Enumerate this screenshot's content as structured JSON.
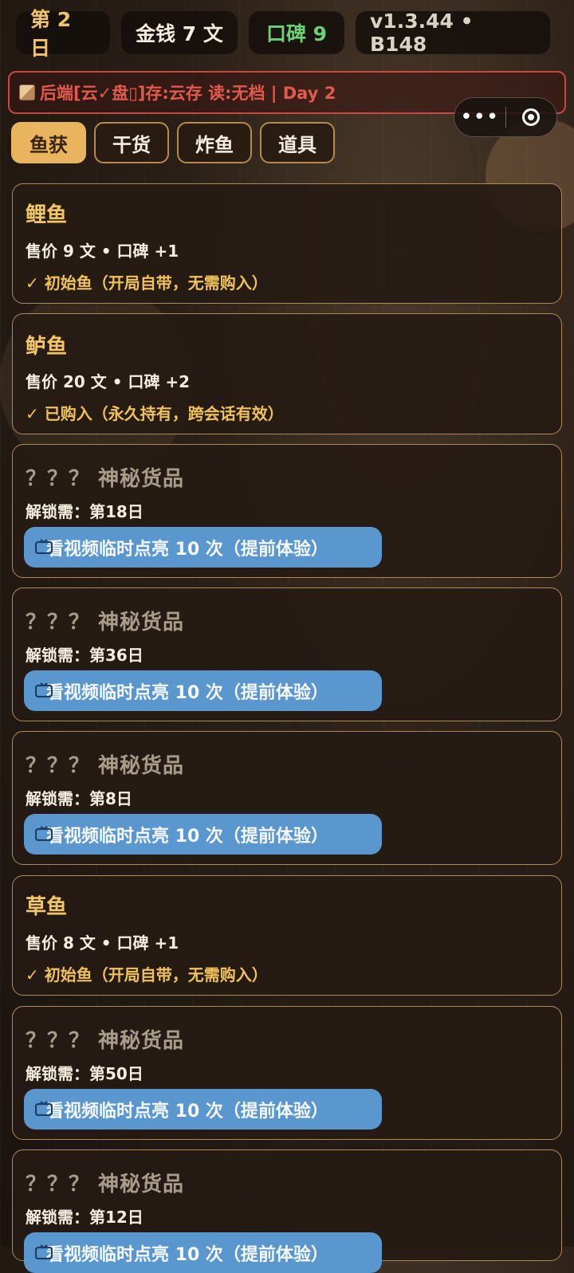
{
  "stats": {
    "day": "第 2 日",
    "money": "金钱 7 文",
    "reputation": "口碑 9",
    "version": "v1.3.44 • B148"
  },
  "banner": {
    "text": "后端[云✓盘▯]存:云存 读:无档 | Day 2"
  },
  "capsule": {
    "more_label": "•••"
  },
  "tabs": [
    {
      "label": "鱼获",
      "active": true
    },
    {
      "label": "干货",
      "active": false
    },
    {
      "label": "炸鱼",
      "active": false
    },
    {
      "label": "道具",
      "active": false
    }
  ],
  "items": [
    {
      "type": "unlocked",
      "name": "鲤鱼",
      "price_line": "售价 9 文 • 口碑 +1",
      "status": "✓ 初始鱼（开局自带，无需购入）"
    },
    {
      "type": "unlocked",
      "name": "鲈鱼",
      "price_line": "售价 20 文 • 口碑 +2",
      "status": "✓ 已购入（永久持有，跨会话有效）"
    },
    {
      "type": "locked",
      "name": "？？？ 神秘货品",
      "unlock": "解锁需：第18日",
      "button": "看视频临时点亮 10 次（提前体验）"
    },
    {
      "type": "locked",
      "name": "？？？ 神秘货品",
      "unlock": "解锁需：第36日",
      "button": "看视频临时点亮 10 次（提前体验）"
    },
    {
      "type": "locked",
      "name": "？？？ 神秘货品",
      "unlock": "解锁需：第8日",
      "button": "看视频临时点亮 10 次（提前体验）"
    },
    {
      "type": "unlocked",
      "name": "草鱼",
      "price_line": "售价 8 文 • 口碑 +1",
      "status": "✓ 初始鱼（开局自带，无需购入）"
    },
    {
      "type": "locked",
      "name": "？？？ 神秘货品",
      "unlock": "解锁需：第50日",
      "button": "看视频临时点亮 10 次（提前体验）"
    },
    {
      "type": "locked",
      "name": "？？？ 神秘货品",
      "unlock": "解锁需：第12日",
      "button": "看视频临时点亮 10 次（提前体验）"
    }
  ],
  "colors": {
    "accent_gold": "#e8b45e",
    "reputation_green": "#6fcf77",
    "banner_red": "#c9473c",
    "video_blue": "#5b97cf"
  }
}
